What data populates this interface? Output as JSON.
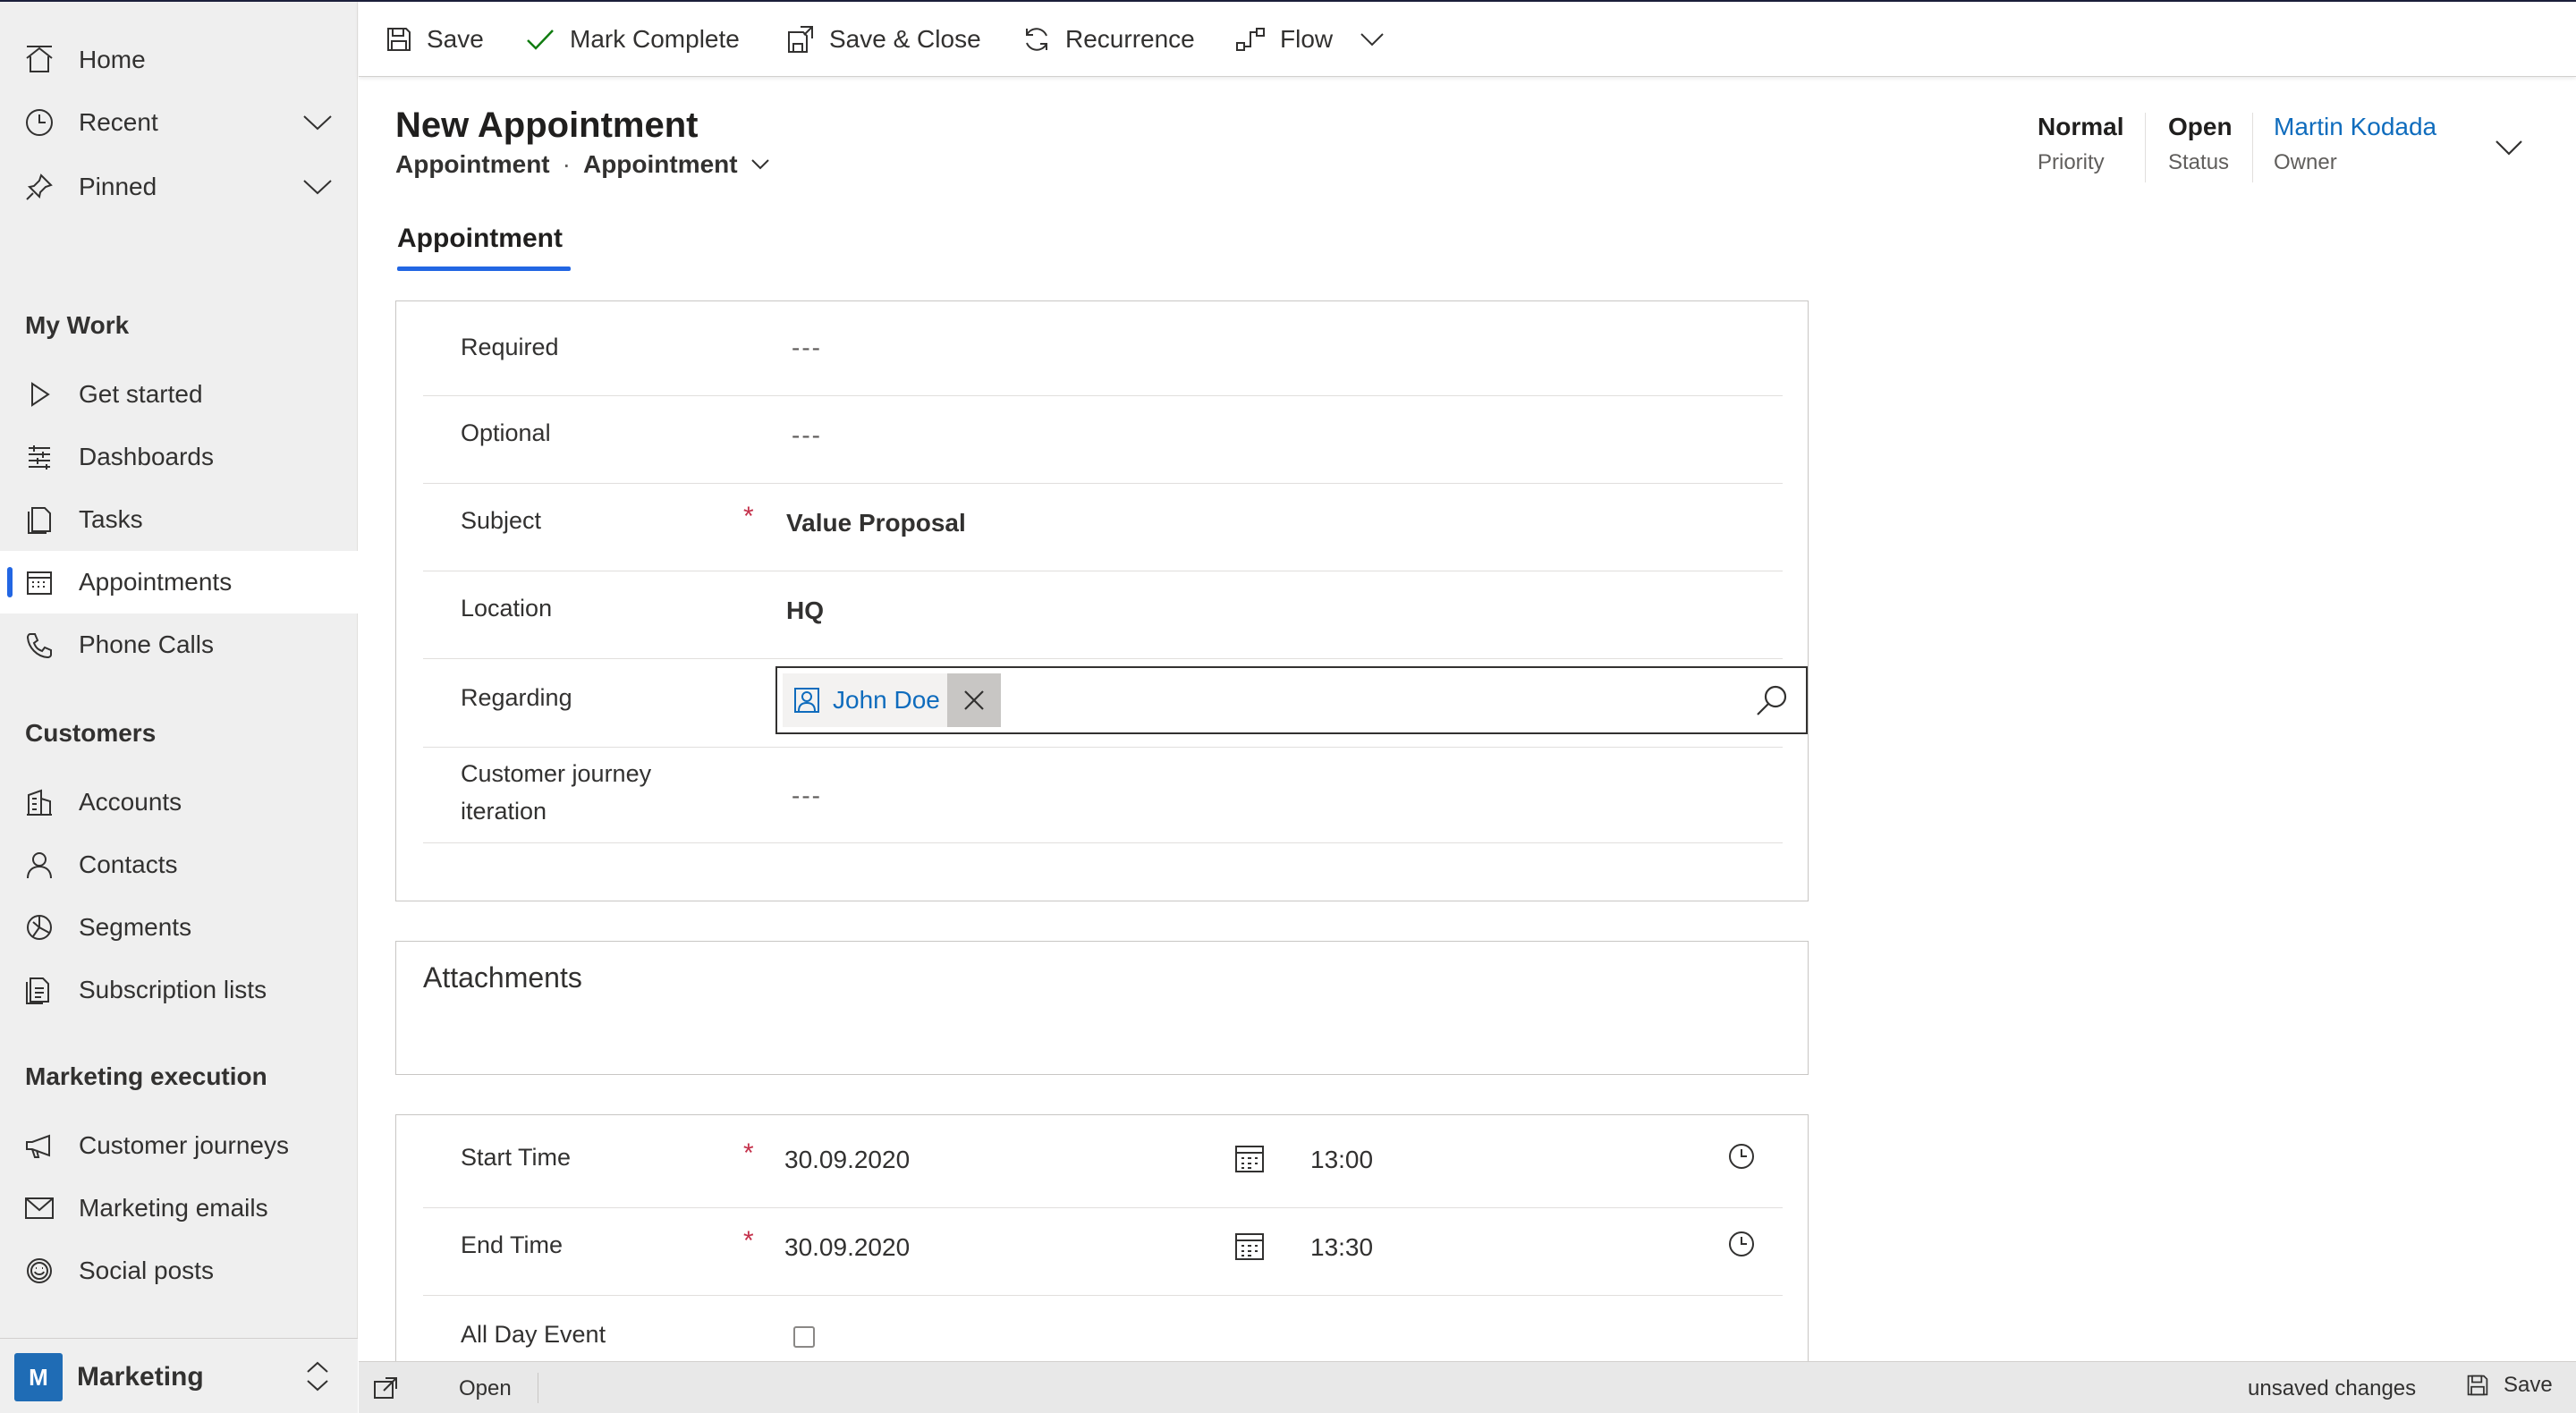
{
  "sidebar": {
    "top_items": [
      {
        "label": "Home",
        "icon": "home-icon"
      },
      {
        "label": "Recent",
        "icon": "clock-icon"
      },
      {
        "label": "Pinned",
        "icon": "pin-icon"
      }
    ],
    "my_work": {
      "title": "My Work",
      "items": [
        {
          "label": "Get started",
          "icon": "play-icon"
        },
        {
          "label": "Dashboards",
          "icon": "dashboard-icon"
        },
        {
          "label": "Tasks",
          "icon": "tasks-icon"
        },
        {
          "label": "Appointments",
          "icon": "calendar-icon",
          "active": true
        },
        {
          "label": "Phone Calls",
          "icon": "phone-icon"
        }
      ]
    },
    "customers": {
      "title": "Customers",
      "items": [
        {
          "label": "Accounts",
          "icon": "building-icon"
        },
        {
          "label": "Contacts",
          "icon": "person-icon"
        },
        {
          "label": "Segments",
          "icon": "segments-icon"
        },
        {
          "label": "Subscription lists",
          "icon": "list-icon"
        }
      ]
    },
    "marketing_execution": {
      "title": "Marketing execution",
      "items": [
        {
          "label": "Customer journeys",
          "icon": "megaphone-icon"
        },
        {
          "label": "Marketing emails",
          "icon": "mail-icon"
        },
        {
          "label": "Social posts",
          "icon": "smile-icon"
        }
      ]
    },
    "area": {
      "badge": "M",
      "label": "Marketing"
    }
  },
  "commands": {
    "save": "Save",
    "mark_complete": "Mark Complete",
    "save_close": "Save & Close",
    "recurrence": "Recurrence",
    "flow": "Flow"
  },
  "header": {
    "title": "New Appointment",
    "entity": "Appointment",
    "separator": "·",
    "form_selector": "Appointment",
    "priority_value": "Normal",
    "priority_label": "Priority",
    "status_value": "Open",
    "status_label": "Status",
    "owner_value": "Martin Kodada",
    "owner_label": "Owner"
  },
  "tab": {
    "label": "Appointment"
  },
  "form": {
    "required": {
      "label": "Required",
      "value": "---"
    },
    "optional": {
      "label": "Optional",
      "value": "---"
    },
    "subject": {
      "label": "Subject",
      "required_mark": "*",
      "value": "Value Proposal"
    },
    "location": {
      "label": "Location",
      "value": "HQ"
    },
    "regarding": {
      "label": "Regarding",
      "tag": "John Doe"
    },
    "journey": {
      "label_line1": "Customer journey",
      "label_line2": "iteration",
      "value": "---"
    }
  },
  "attachments": {
    "title": "Attachments"
  },
  "schedule": {
    "start": {
      "label": "Start Time",
      "required_mark": "*",
      "date": "30.09.2020",
      "time": "13:00"
    },
    "end": {
      "label": "End Time",
      "required_mark": "*",
      "date": "30.09.2020",
      "time": "13:30"
    },
    "all_day": {
      "label": "All Day Event"
    }
  },
  "statusbar": {
    "status": "Open",
    "unsaved": "unsaved changes",
    "save": "Save"
  },
  "colors": {
    "accent": "#2266e3",
    "link": "#0f6cbd",
    "required": "#c4314b",
    "sidebar_bg": "#efefef",
    "area_badge": "#1f6cb5"
  }
}
